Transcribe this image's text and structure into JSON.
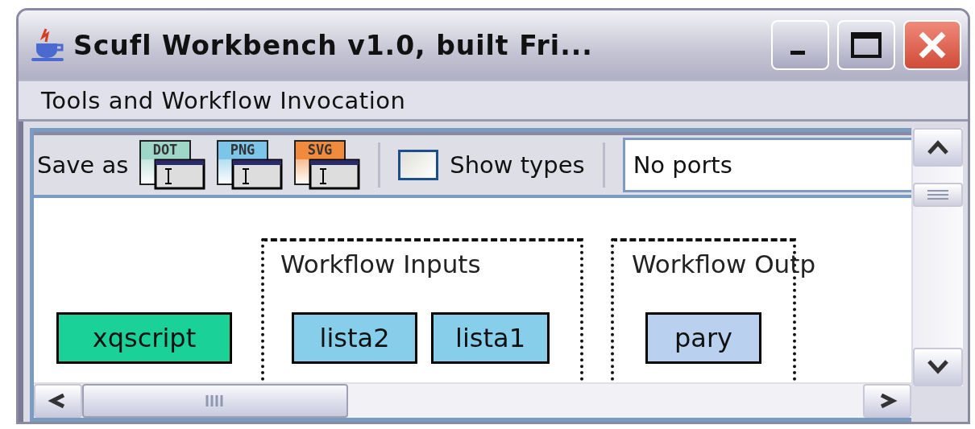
{
  "window": {
    "title": "Scufl Workbench v1.0, built Fri..."
  },
  "menu": [
    {
      "label": "Tools and Workflow Invocation"
    }
  ],
  "toolbar": {
    "save_label": "Save as",
    "formats": [
      {
        "label": "DOT",
        "color": "#9ed6c8"
      },
      {
        "label": "PNG",
        "color": "#7cc4e8"
      },
      {
        "label": "SVG",
        "color": "#f08a3c"
      }
    ],
    "show_types": {
      "label": "Show types",
      "checked": false
    },
    "ports": {
      "value": "No ports"
    }
  },
  "graph": {
    "clusters": [
      {
        "label": "Workflow Inputs"
      },
      {
        "label": "Workflow Outp"
      }
    ],
    "nodes": [
      {
        "label": "xqscript",
        "color": "#1ad197"
      },
      {
        "label": "lista2",
        "color": "#87ceeb"
      },
      {
        "label": "lista1",
        "color": "#87ceeb"
      },
      {
        "label": "pary",
        "color": "#b9d1ee"
      }
    ]
  }
}
